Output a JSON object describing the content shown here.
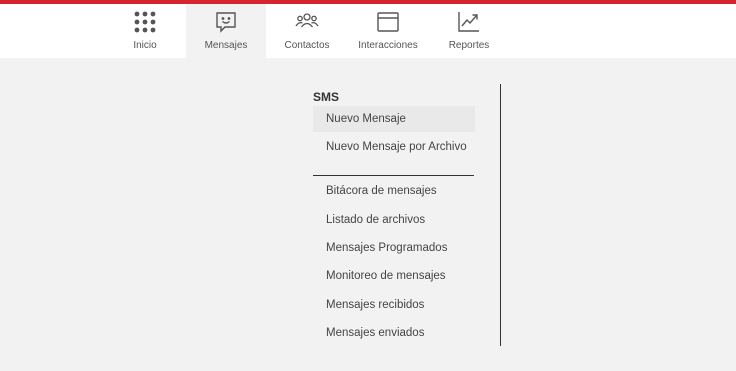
{
  "nav": {
    "items": [
      {
        "label": "Inicio",
        "icon": "grid-icon"
      },
      {
        "label": "Mensajes",
        "icon": "message-icon"
      },
      {
        "label": "Contactos",
        "icon": "contacts-icon"
      },
      {
        "label": "Interacciones",
        "icon": "window-icon"
      },
      {
        "label": "Reportes",
        "icon": "chart-icon"
      }
    ],
    "active": "Mensajes"
  },
  "menu": {
    "section_title": "SMS",
    "group1": [
      "Nuevo Mensaje",
      "Nuevo Mensaje por Archivo"
    ],
    "group2": [
      "Bitácora de mensajes",
      "Listado de archivos",
      "Mensajes Programados",
      "Monitoreo de mensajes",
      "Mensajes recibidos",
      "Mensajes enviados"
    ]
  },
  "colors": {
    "accent": "#d4262c",
    "background": "#f2f2f2",
    "navbar": "#ffffff"
  }
}
